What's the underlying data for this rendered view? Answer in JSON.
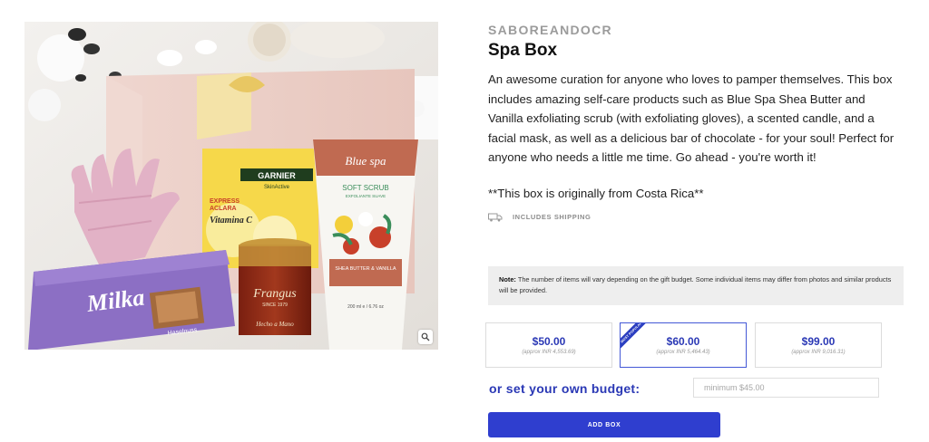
{
  "product": {
    "vendor": "SABOREANDOCR",
    "title": "Spa Box",
    "description": "An awesome curation for anyone who loves to pamper themselves. This box includes amazing self-care products such as Blue Spa Shea Butter and Vanilla exfoliating scrub (with exfoliating gloves), a scented candle, and a facial mask, as well as a delicious bar of chocolate - for your soul! Perfect for anyone who needs a little me time. Go ahead - you're worth it!",
    "origin_note": "**This box is originally from Costa Rica**",
    "shipping_label": "INCLUDES SHIPPING"
  },
  "image": {
    "zoom_icon": "magnifier-icon",
    "labels": {
      "milka": "Milka",
      "milka_sub": "Haselnuss",
      "garnier": "GARNIER",
      "garnier_sub": "SkinActive",
      "mask_line1": "EXPRESS",
      "mask_line2": "ACLARA",
      "mask_line3": "Vitamina C",
      "scrub_brand": "Blue spa",
      "scrub_name": "SOFT SCRUB",
      "scrub_sub": "EXFOLIANTE SUAVE",
      "scrub_flavor": "SHEA BUTTER & VANILLA",
      "scrub_size": "200 ml e / 6.76 oz",
      "candle_brand": "Frangus",
      "candle_since": "SINCE 1979",
      "candle_hand": "Hecho a Mano"
    }
  },
  "note": {
    "label": "Note:",
    "text": "The number of items will vary depending on the gift budget. Some individual items may differ from photos and similar products will be provided."
  },
  "tiers": [
    {
      "price": "$50.00",
      "approx": "(approx INR 4,553.69)",
      "selected": false
    },
    {
      "price": "$60.00",
      "approx": "(approx INR 5,464.43)",
      "selected": true,
      "badge": "MOST POPULAR"
    },
    {
      "price": "$99.00",
      "approx": "(approx INR 9,016.31)",
      "selected": false
    }
  ],
  "budget": {
    "label": "or set your own budget:",
    "placeholder": "minimum $45.00",
    "value": ""
  },
  "cta": {
    "label": "ADD BOX"
  },
  "colors": {
    "accent": "#2f3ecf",
    "accent_text": "#2a38b5",
    "vendor_gray": "#9b9b9b",
    "note_bg": "#eeeeee"
  }
}
